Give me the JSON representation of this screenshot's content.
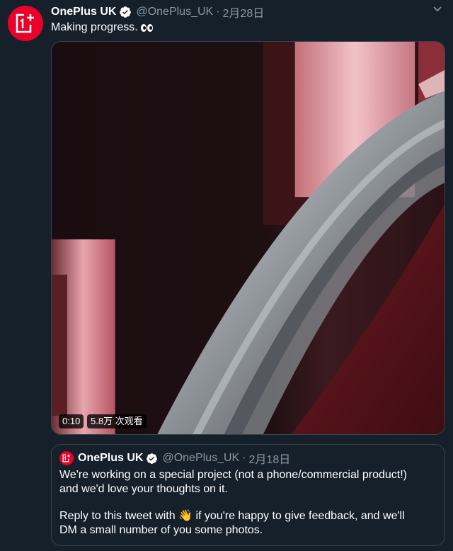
{
  "tweet": {
    "display_name": "OnePlus UK",
    "handle": "@OnePlus_UK",
    "separator": "·",
    "date": "2月28日",
    "text": "Making progress.",
    "emoji": "eyes-emoji",
    "colors": {
      "background": "#15202b",
      "brand_red": "#eb0028",
      "secondary_text": "#8899a6",
      "border": "#38444d"
    }
  },
  "video": {
    "duration": "0:10",
    "views": "5.8万 次观看"
  },
  "quoted_tweet": {
    "display_name": "OnePlus UK",
    "handle": "@OnePlus_UK",
    "separator": "·",
    "date": "2月18日",
    "line1": "We're working on a special project (not a phone/commercial product!)",
    "line2": "and we'd love your thoughts on it.",
    "line3_a": "Reply to this tweet with ",
    "line3_emoji": "👋",
    "line3_b": " if you're happy to give feedback, and we'll",
    "line4": "DM a small number of you some photos."
  }
}
